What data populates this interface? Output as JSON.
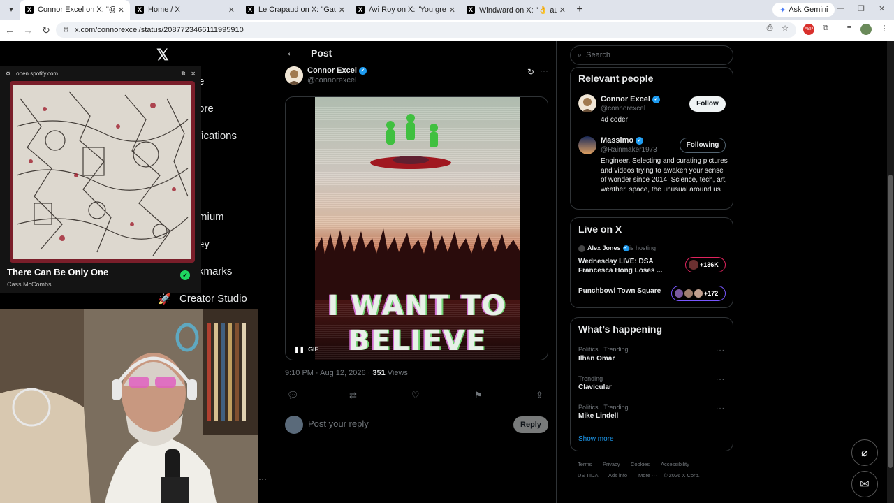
{
  "browser": {
    "tabs": [
      {
        "title": "Connor Excel on X: \"@Rainmak",
        "active": true
      },
      {
        "title": "Home / X",
        "active": false
      },
      {
        "title": "Le Crapaud on X: \"Gauchiste vo",
        "active": false
      },
      {
        "title": "Avi Roy on X: \"You grew two se",
        "active": false
      },
      {
        "title": "Windward on X: \"👌 au Two of",
        "active": false
      }
    ],
    "gemini_label": "Ask Gemini",
    "url": "x.com/connorexcel/status/2087723466111995910"
  },
  "left_nav": {
    "items": [
      "e",
      "ore",
      "fications",
      "mium",
      "ey",
      "kmarks",
      "Creator Studio"
    ]
  },
  "spotify": {
    "domain": "open.spotify.com",
    "track_title": "There Can Be Only One",
    "artist": "Cass McCombs"
  },
  "post": {
    "header_title": "Post",
    "author_name": "Connor Excel",
    "author_handle": "@connorexcel",
    "gif_text_line1": "I WANT TO",
    "gif_text_line2": "BELIEVE",
    "gif_badge": "GIF",
    "timestamp": "9:10 PM · Aug 12, 2026 · ",
    "views_count": "351",
    "views_label": " Views",
    "reply_placeholder": "Post your reply",
    "reply_button": "Reply"
  },
  "sidebar": {
    "search_placeholder": "Search",
    "relevant_people": {
      "title": "Relevant people",
      "people": [
        {
          "name": "Connor Excel",
          "handle": "@connorexcel",
          "bio": "4d coder",
          "button": "Follow"
        },
        {
          "name": "Massimo",
          "handle": "@Rainmaker1973",
          "bio": "Engineer. Selecting and curating pictures and videos trying to awaken your sense of wonder since 2014. Science, tech, art, weather, space, the unusual around us",
          "button": "Following"
        }
      ]
    },
    "live": {
      "title": "Live on X",
      "host_name": "Alex Jones",
      "host_suffix": "is hosting",
      "spaces": [
        {
          "title": "Wednesday LIVE: DSA Francesca Hong Loses ...",
          "count": "+136K"
        },
        {
          "title": "Punchbowl Town Square",
          "count": "+172"
        }
      ]
    },
    "happening": {
      "title": "What’s happening",
      "trends": [
        {
          "category": "Politics · Trending",
          "name": "Ilhan Omar"
        },
        {
          "category": "Trending",
          "name": "Clavicular"
        },
        {
          "category": "Politics · Trending",
          "name": "Mike Lindell"
        }
      ],
      "show_more": "Show more"
    },
    "footer_line1": [
      "Terms",
      "Privacy",
      "Cookies",
      "Accessibility"
    ],
    "footer_line2": [
      "US TIDA",
      "Ads info",
      "More ···",
      "© 2026 X Corp."
    ]
  },
  "colors": {
    "accent": "#1d9bf0",
    "live_ring": "#e0245e",
    "spotify_green": "#1ed760"
  }
}
